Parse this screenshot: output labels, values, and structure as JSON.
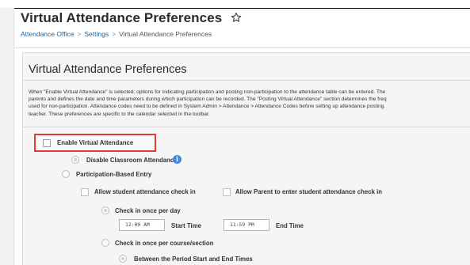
{
  "header": {
    "title": "Virtual Attendance Preferences",
    "breadcrumb": [
      "Attendance Office",
      "Settings",
      "Virtual Attendance Preferences"
    ]
  },
  "section": {
    "title": "Virtual Attendance Preferences",
    "description_lines": [
      "When \"Enable Virtual Attendance\" is selected, options for indicating participation and posting non-participation to the attendance table can be entered. The",
      "parents and defines the date and time parameters during which participation can be recorded. The \"Posting Virtual Attendance\" section determines the freq",
      "used for non-participation. Attendance codes need to be defined in System Admin > Attendance > Attendance Codes before setting up attendance posting.",
      "teacher. These preferences are specific to the calendar selected in the toolbar."
    ]
  },
  "form": {
    "enable_virtual": "Enable Virtual Attendance",
    "disable_classroom": "Disable Classroom Attendance",
    "participation_entry": "Participation-Based Entry",
    "allow_student": "Allow student attendance check in",
    "allow_parent": "Allow Parent to enter student attendance check in",
    "check_once_day": "Check in once per day",
    "start_time_value": "12:00 AM",
    "start_time_label": "Start Time",
    "end_time_value": "11:59 PM",
    "end_time_label": "End Time",
    "check_once_course": "Check in once per course/section",
    "between_period": "Between the Period Start and End Times"
  },
  "colors": {
    "link": "#1a65a5",
    "highlight": "#e53935",
    "info": "#3f8ad6"
  }
}
